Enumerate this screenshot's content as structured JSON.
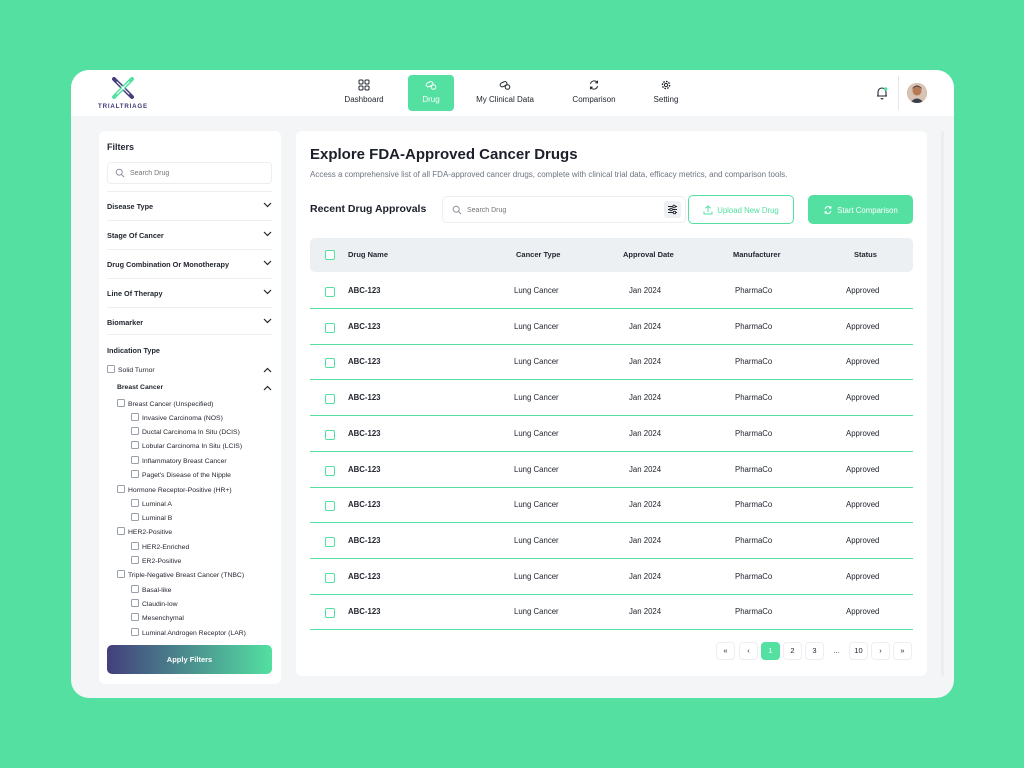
{
  "brand": {
    "name": "TRIALTRIAGE",
    "colors": {
      "accent": "#53e0a1",
      "brand_purple": "#433f7c"
    }
  },
  "nav": {
    "items": [
      {
        "label": "Dashboard",
        "icon": "grid-icon"
      },
      {
        "label": "Drug",
        "icon": "pills-icon",
        "active": true
      },
      {
        "label": "My Clinical Data",
        "icon": "pills-icon"
      },
      {
        "label": "Comparison",
        "icon": "refresh-icon"
      },
      {
        "label": "Setting",
        "icon": "gear-icon"
      }
    ]
  },
  "sidebar": {
    "title": "Filters",
    "search_placeholder": "Search Drug",
    "accordions": [
      "Disease Type",
      "Stage Of Cancer",
      "Drug Combination Or Monotherapy",
      "Line Of Therapy",
      "Biomarker"
    ],
    "indication_title": "Indication Type",
    "tree": {
      "solid_tumor": "Solid Turnor",
      "breast_cancer": "Breast Cancer",
      "items": [
        "Breast Cancer (Unspecified)",
        "Invasive Carcinoma (NOS)",
        "Ductal Carcinoma In Situ (DCIS)",
        "Lobular Carcinoma In Situ (LCIS)",
        "Inflammatory Breast Cancer",
        "Paget's Disease of the Nipple",
        "Hormone Receptor-Positive (HR+)",
        "Luminal A",
        "Luminal B",
        "HER2-Positive",
        "HER2-Enriched",
        "ER2-Positive",
        "Triple-Negative Breast Cancer (TNBC)",
        "Basal-like",
        "Claudin-low",
        "Mesenchymal",
        "Luminal Androgen Receptor (LAR)"
      ]
    },
    "apply_label": "Apply Filters"
  },
  "main": {
    "title": "Explore FDA-Approved Cancer Drugs",
    "subtitle": "Access a comprehensive list of all FDA-approved cancer drugs, complete with clinical trial data, efficacy metrics, and comparison tools.",
    "section_title": "Recent Drug Approvals",
    "search_placeholder": "Search Drug",
    "upload_label": "Upload New Drug",
    "compare_label": "Start Comparison"
  },
  "table": {
    "headers": [
      "Drug Name",
      "Cancer Type",
      "Approval Date",
      "Manufacturer",
      "Status"
    ],
    "rows": [
      [
        "ABC-123",
        "Lung Cancer",
        "Jan 2024",
        "PharmaCo",
        "Approved"
      ],
      [
        "ABC-123",
        "Lung Cancer",
        "Jan 2024",
        "PharmaCo",
        "Approved"
      ],
      [
        "ABC-123",
        "Lung Cancer",
        "Jan 2024",
        "PharmaCo",
        "Approved"
      ],
      [
        "ABC-123",
        "Lung Cancer",
        "Jan 2024",
        "PharmaCo",
        "Approved"
      ],
      [
        "ABC-123",
        "Lung Cancer",
        "Jan 2024",
        "PharmaCo",
        "Approved"
      ],
      [
        "ABC-123",
        "Lung Cancer",
        "Jan 2024",
        "PharmaCo",
        "Approved"
      ],
      [
        "ABC-123",
        "Lung Cancer",
        "Jan 2024",
        "PharmaCo",
        "Approved"
      ],
      [
        "ABC-123",
        "Lung Cancer",
        "Jan 2024",
        "PharmaCo",
        "Approved"
      ],
      [
        "ABC-123",
        "Lung Cancer",
        "Jan 2024",
        "PharmaCo",
        "Approved"
      ],
      [
        "ABC-123",
        "Lung Cancer",
        "Jan 2024",
        "PharmaCo",
        "Approved"
      ]
    ]
  },
  "pagination": {
    "first": "«",
    "prev": "‹",
    "pages": [
      "1",
      "2",
      "3"
    ],
    "ellipsis": "...",
    "last_page": "10",
    "next": "›",
    "last": "»",
    "current": "1"
  }
}
